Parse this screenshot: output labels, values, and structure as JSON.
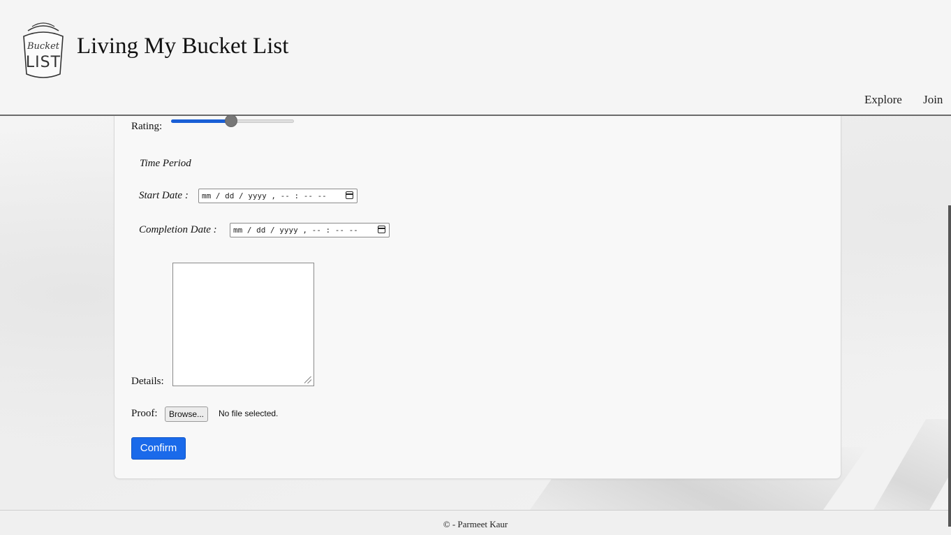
{
  "header": {
    "brand_title": "Living My Bucket List",
    "logo_text_line1": "Bucket",
    "logo_text_line2": "LIST",
    "nav": [
      "Explore",
      "Join"
    ]
  },
  "form": {
    "rating_label": "Rating:",
    "rating_value_fraction": 0.49,
    "time_period_title": "Time Period",
    "start_date_label": "Start Date :",
    "start_date_placeholder": "mm / dd / yyyy ,  -- : --  --",
    "completion_date_label": "Completion Date :",
    "completion_date_placeholder": "mm / dd / yyyy ,  -- : --  --",
    "details_label": "Details:",
    "details_value": "",
    "proof_label": "Proof:",
    "browse_button_label": "Browse...",
    "file_status": "No file selected.",
    "confirm_button_label": "Confirm"
  },
  "footer": {
    "text": "© - Parmeet Kaur"
  },
  "colors": {
    "accent": "#1a6aea",
    "slider_fill": "#1a5fd6"
  }
}
